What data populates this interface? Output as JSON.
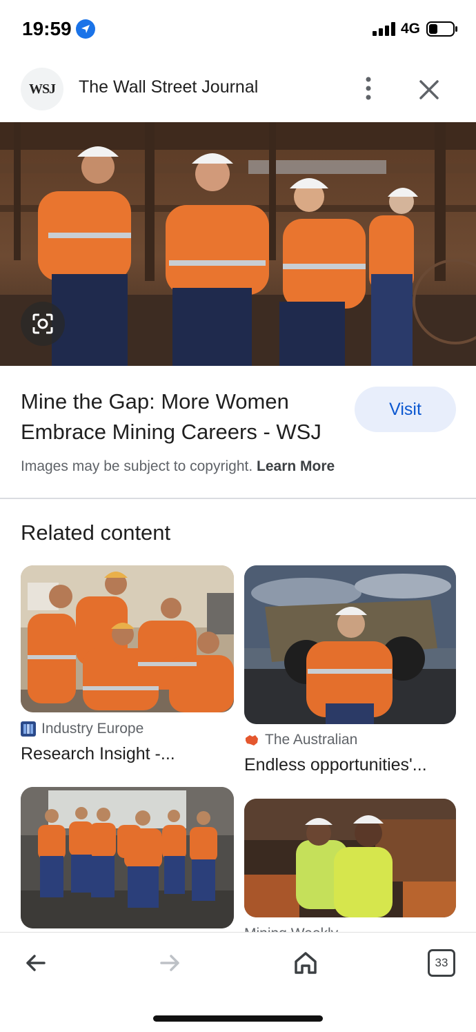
{
  "status_bar": {
    "time": "19:59",
    "network": "4G"
  },
  "header": {
    "logo_text": "WSJ",
    "site_title": "The Wall Street Journal"
  },
  "result": {
    "headline": "Mine the Gap: More Women Embrace Mining Careers - WSJ",
    "visit_label": "Visit",
    "copyright_text": "Images may be subject to copyright.",
    "learn_more": "Learn More"
  },
  "related": {
    "title": "Related content",
    "items": [
      {
        "source": "Industry Europe",
        "caption": "Research Insight -..."
      },
      {
        "source": "The Australian",
        "caption": "Endless opportunities'..."
      },
      {
        "source": "",
        "caption": ""
      },
      {
        "source": "Mining Weekly",
        "caption": ""
      }
    ]
  },
  "bottom_nav": {
    "tab_count": "33"
  },
  "colors": {
    "accent": "#0b57d0",
    "visit_bg": "#e8eefb",
    "hi_vis_orange": "#e9752f"
  }
}
